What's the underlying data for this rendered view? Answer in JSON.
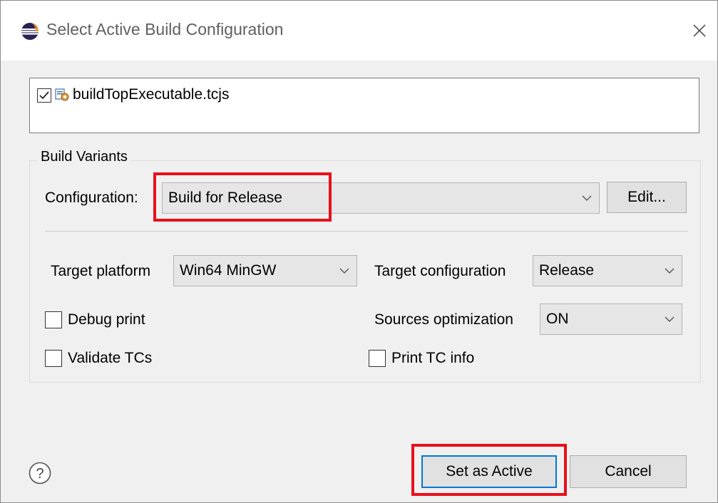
{
  "window": {
    "title": "Select Active Build Configuration",
    "icon": "eclipse-icon",
    "close_icon": "close-icon"
  },
  "project_list": {
    "items": [
      {
        "label": "buildTopExecutable.tcjs",
        "checked": true,
        "icon": "project-icon"
      }
    ]
  },
  "build_variants": {
    "group_label": "Build Variants",
    "configuration_label": "Configuration:",
    "configuration_value": "Build for Release",
    "edit_label": "Edit...",
    "target_platform_label": "Target platform",
    "target_platform_value": "Win64 MinGW",
    "target_configuration_label": "Target configuration",
    "target_configuration_value": "Release",
    "debug_print_label": "Debug print",
    "debug_print_checked": false,
    "sources_optimization_label": "Sources optimization",
    "sources_optimization_value": "ON",
    "validate_tcs_label": "Validate TCs",
    "validate_tcs_checked": false,
    "print_tc_info_label": "Print TC info",
    "print_tc_info_checked": false
  },
  "footer": {
    "help_icon": "help-icon",
    "set_active_label": "Set as Active",
    "cancel_label": "Cancel"
  },
  "colors": {
    "highlight": "#e8101a",
    "focus_border": "#0078d7",
    "dialog_bg": "#f0f0f0"
  }
}
